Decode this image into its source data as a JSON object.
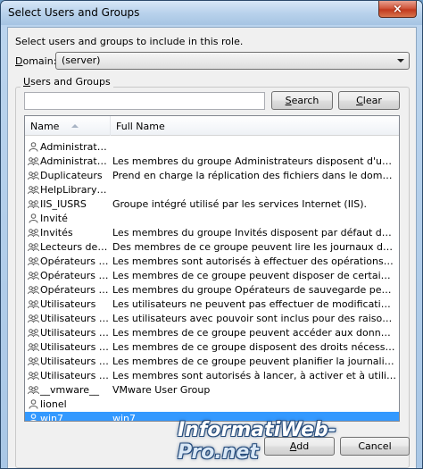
{
  "window": {
    "title": "Select Users and Groups",
    "close_label": "×"
  },
  "instruction": "Select users and groups to include in this role.",
  "domain": {
    "label_prefix": "",
    "label_accel": "D",
    "label_rest": "omain:",
    "value": "(server)"
  },
  "group": {
    "title_accel": "U",
    "title_rest": "sers and Groups",
    "search_value": "",
    "search_accel": "S",
    "search_rest": "earch",
    "clear_accel": "C",
    "clear_rest": "lear"
  },
  "list": {
    "columns": {
      "name": "Name",
      "full": "Full Name"
    },
    "rows": [
      {
        "name": "Administrateur",
        "full": "",
        "icon": "user"
      },
      {
        "name": "Administrateurs",
        "full": "Les membres du groupe Administrateurs disposent d'un accès comp...",
        "icon": "group"
      },
      {
        "name": "Duplicateurs",
        "full": "Prend en charge la réplication des fichiers dans le domaine",
        "icon": "group"
      },
      {
        "name": "HelpLibraryU...",
        "full": "",
        "icon": "group"
      },
      {
        "name": "IIS_IUSRS",
        "full": "Groupe intégré utilisé par les services Internet (IIS).",
        "icon": "group"
      },
      {
        "name": "Invité",
        "full": "",
        "icon": "user"
      },
      {
        "name": "Invités",
        "full": "Les membres du groupe Invités disposent par défaut du même accè...",
        "icon": "group"
      },
      {
        "name": "Lecteurs des ...",
        "full": "Des membres de ce groupe peuvent lire les journaux des événeme...",
        "icon": "group"
      },
      {
        "name": "Opérateurs d...",
        "full": "Les membres sont autorisés à effectuer des opérations de chiffrem...",
        "icon": "group"
      },
      {
        "name": "Opérateurs d...",
        "full": "Les membres de ce groupe peuvent disposer de certaines autorisat...",
        "icon": "group"
      },
      {
        "name": "Opérateurs d...",
        "full": "Les membres du groupe Opérateurs de sauvegarde peuvent passe...",
        "icon": "group"
      },
      {
        "name": "Utilisateurs",
        "full": "Les utilisateurs ne peuvent pas effectuer de modifications accident...",
        "icon": "group"
      },
      {
        "name": "Utilisateurs d...",
        "full": "Les utilisateurs avec pouvoir sont inclus pour des raisons de compa...",
        "icon": "group"
      },
      {
        "name": "Utilisateurs d...",
        "full": "Les membres de ce groupe peuvent accéder aux données de compt...",
        "icon": "group"
      },
      {
        "name": "Utilisateurs d...",
        "full": "Les membres de ce groupe disposent des droits nécessaires pour ...",
        "icon": "group"
      },
      {
        "name": "Utilisateurs d...",
        "full": "Les membres de ce groupe peuvent planifier la journalisation des...",
        "icon": "group"
      },
      {
        "name": "Utilisateurs d...",
        "full": "Les membres sont autorisés à lancer, à activer et à utiliser sur cet ...",
        "icon": "group"
      },
      {
        "name": "__vmware__",
        "full": "VMware User Group",
        "icon": "group"
      },
      {
        "name": "lionel",
        "full": "",
        "icon": "user"
      },
      {
        "name": "win7",
        "full": "win7",
        "icon": "user",
        "selected": true
      }
    ]
  },
  "buttons": {
    "add_accel": "A",
    "add_rest": "dd",
    "cancel": "Cancel"
  },
  "watermark": {
    "main": "InformatiWeb",
    "suffix": "-Pro.net"
  },
  "colors": {
    "selection": "#3399ff",
    "title_gradient_top": "#d7e7f7",
    "close_red": "#c23a1e"
  }
}
